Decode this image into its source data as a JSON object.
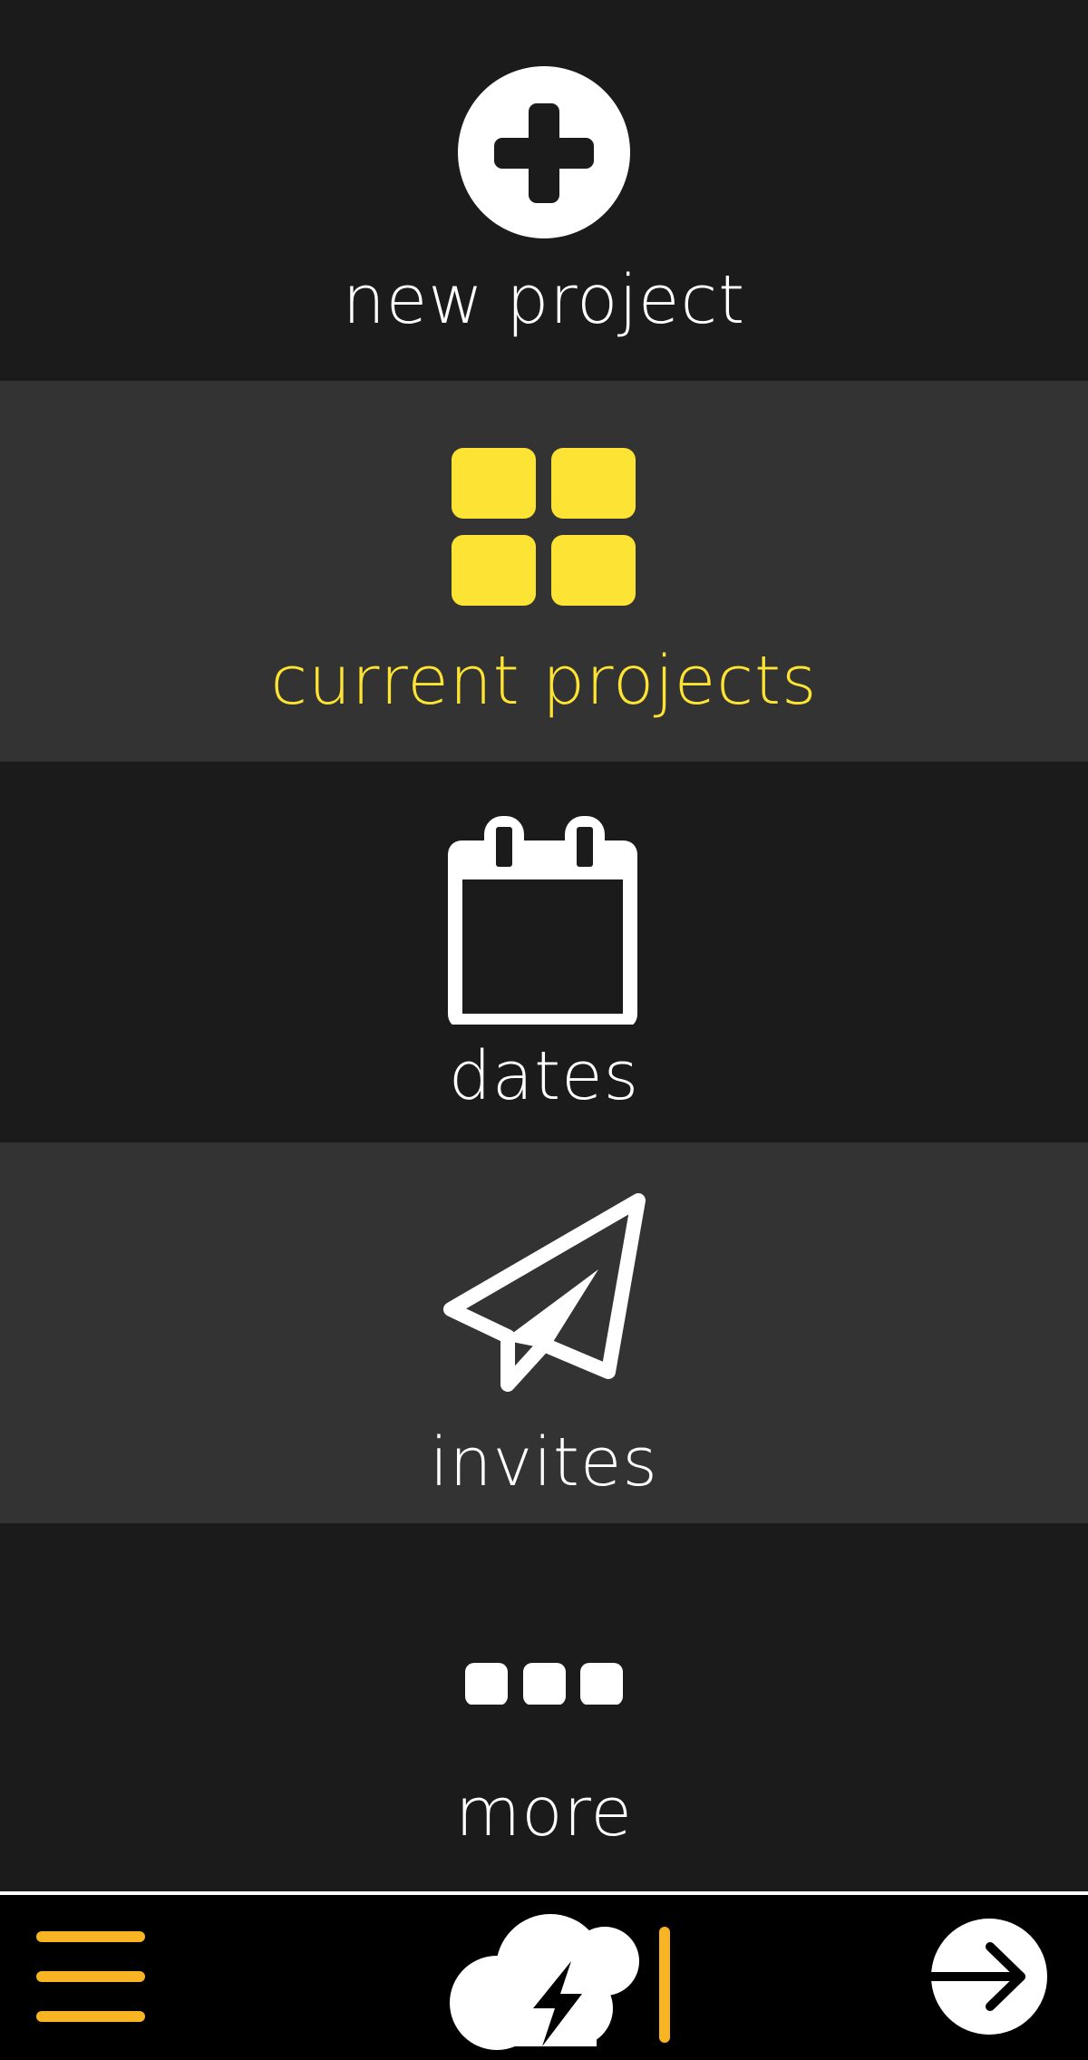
{
  "colors": {
    "background": "#1b1b1b",
    "row_alt": "#333333",
    "active": "#fde333",
    "text": "#ffffff",
    "accent": "#f9b424",
    "bottom_bar": "#000000"
  },
  "menu": {
    "items": [
      {
        "label": "new project",
        "icon": "plus-circle-icon",
        "active": false
      },
      {
        "label": "current projects",
        "icon": "grid-icon",
        "active": true
      },
      {
        "label": "dates",
        "icon": "calendar-icon",
        "active": false
      },
      {
        "label": "invites",
        "icon": "paper-plane-icon",
        "active": false
      },
      {
        "label": "more",
        "icon": "more-dots-icon",
        "active": false
      }
    ]
  },
  "bottom_bar": {
    "left_icon": "hamburger-menu-icon",
    "center_icon": "cloud-lightning-logo-icon",
    "right_icon": "arrow-right-circle-icon"
  }
}
